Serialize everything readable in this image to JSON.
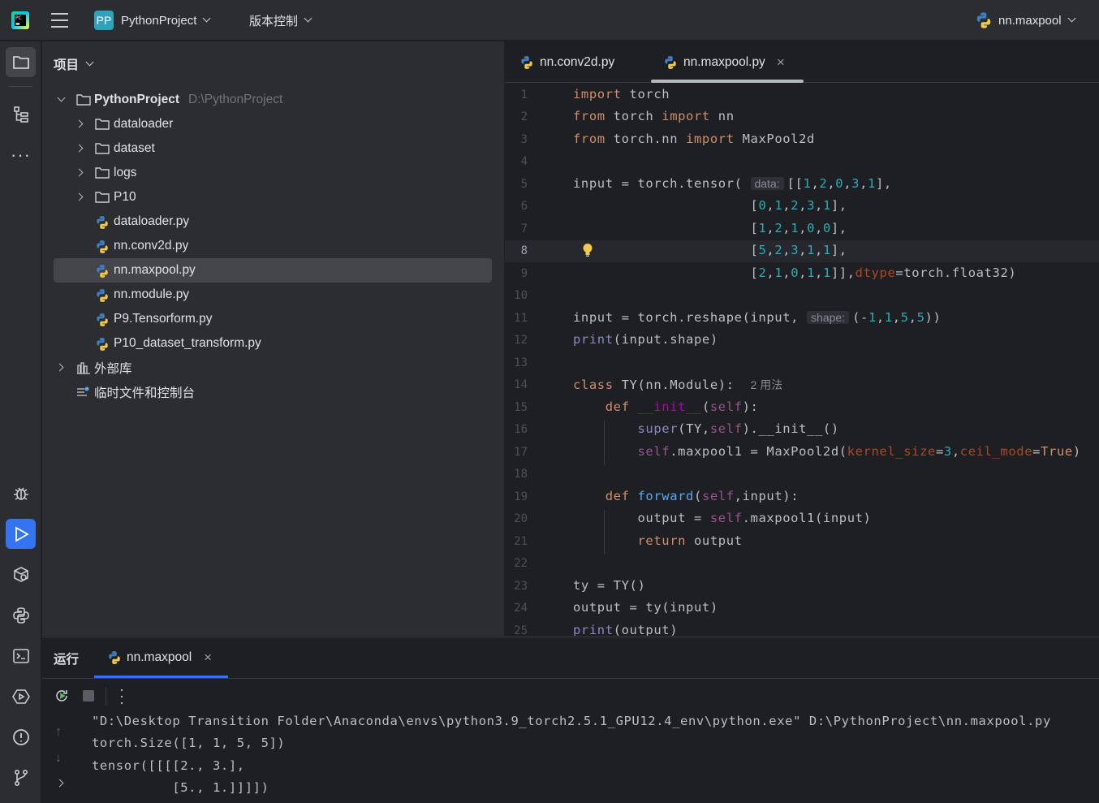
{
  "topbar": {
    "project_badge": "PP",
    "project_name": "PythonProject",
    "vcs_label": "版本控制",
    "run_config": "nn.maxpool"
  },
  "project_panel": {
    "title": "项目",
    "root_name": "PythonProject",
    "root_path": "D:\\PythonProject",
    "items": [
      {
        "label": "dataloader",
        "type": "folder"
      },
      {
        "label": "dataset",
        "type": "folder"
      },
      {
        "label": "logs",
        "type": "folder"
      },
      {
        "label": "P10",
        "type": "folder"
      },
      {
        "label": "dataloader.py",
        "type": "py"
      },
      {
        "label": "nn.conv2d.py",
        "type": "py"
      },
      {
        "label": "nn.maxpool.py",
        "type": "py",
        "selected": true
      },
      {
        "label": "nn.module.py",
        "type": "py"
      },
      {
        "label": "P9.Tensorform.py",
        "type": "py"
      },
      {
        "label": "P10_dataset_transform.py",
        "type": "py"
      }
    ],
    "external_libs": "外部库",
    "scratches": "临时文件和控制台"
  },
  "editor": {
    "tabs": [
      {
        "label": "nn.conv2d.py",
        "active": false
      },
      {
        "label": "nn.maxpool.py",
        "active": true
      }
    ],
    "current_line": 8,
    "hints": {
      "data": "data:",
      "shape": "shape:",
      "usages": "2 用法"
    },
    "line_numbers": [
      "1",
      "2",
      "3",
      "4",
      "5",
      "6",
      "7",
      "8",
      "9",
      "10",
      "11",
      "12",
      "13",
      "14",
      "15",
      "16",
      "17",
      "18",
      "19",
      "20",
      "21",
      "22",
      "23",
      "24",
      "25"
    ]
  },
  "run_panel": {
    "title": "运行",
    "tab_label": "nn.maxpool",
    "output": [
      "\"D:\\Desktop Transition Folder\\Anaconda\\envs\\python3.9_torch2.5.1_GPU12.4_env\\python.exe\" D:\\PythonProject\\nn.maxpool.py",
      "torch.Size([1, 1, 5, 5])",
      "tensor([[[[2., 3.],",
      "          [5., 1.]]]])"
    ]
  },
  "colors": {
    "accent": "#3574f0",
    "keyword": "#cf8e6d",
    "number": "#2aacb8",
    "function": "#56a8f5",
    "self": "#94558d",
    "builtin": "#8888c6"
  }
}
